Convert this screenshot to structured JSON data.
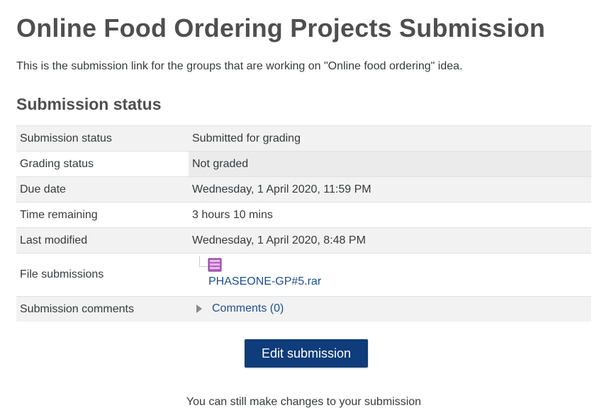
{
  "page": {
    "title": "Online Food Ordering Projects Submission",
    "intro": "This is the submission link for the groups that are working on \"Online food ordering\" idea."
  },
  "status": {
    "heading": "Submission status",
    "rows": [
      {
        "label": "Submission status",
        "value": "Submitted for grading"
      },
      {
        "label": "Grading status",
        "value": "Not graded"
      },
      {
        "label": "Due date",
        "value": "Wednesday, 1 April 2020, 11:59 PM"
      },
      {
        "label": "Time remaining",
        "value": "3 hours 10 mins"
      },
      {
        "label": "Last modified",
        "value": "Wednesday, 1 April 2020, 8:48 PM"
      }
    ],
    "file_submissions": {
      "label": "File submissions",
      "file_name": "PHASEONE-GP#5.rar",
      "icon": "archive-icon"
    },
    "comments": {
      "label": "Submission comments",
      "link": "Comments (0)",
      "icon": "expand-triangle-icon"
    }
  },
  "actions": {
    "edit_label": "Edit submission",
    "help_text": "You can still make changes to your submission"
  },
  "colors": {
    "primary_button": "#0f3c7a",
    "link": "#1e4f8f",
    "heading": "#4f4f4f",
    "stripe": "#f2f2f2"
  }
}
